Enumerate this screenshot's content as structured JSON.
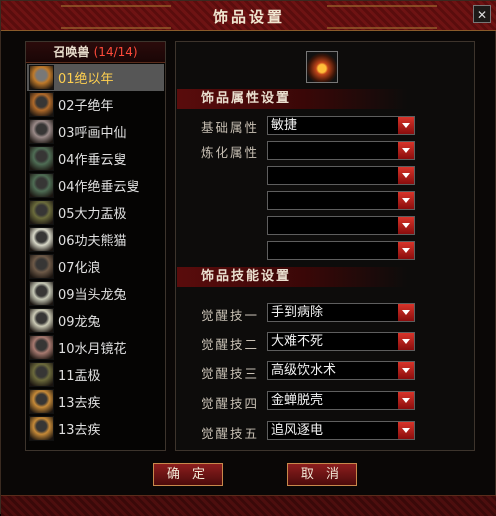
{
  "window": {
    "title": "饰品设置",
    "close_icon": "✕"
  },
  "summon_list": {
    "header_label": "召唤兽",
    "count": "(14/14)",
    "items": [
      {
        "label": "01绝以年",
        "selected": true,
        "color": "#c07a2a"
      },
      {
        "label": "02子绝年",
        "color": "#b06a2a"
      },
      {
        "label": "03呼画中仙",
        "color": "#9a8a88"
      },
      {
        "label": "04作垂云叟",
        "color": "#4f6d55"
      },
      {
        "label": "04作绝垂云叟",
        "color": "#4f6d55"
      },
      {
        "label": "05大力盂极",
        "color": "#6b6c3c"
      },
      {
        "label": "06功夫熊猫",
        "color": "#d8d8c8"
      },
      {
        "label": "07化浪",
        "color": "#6e5a48"
      },
      {
        "label": "09当头龙兔",
        "color": "#c6c8b6"
      },
      {
        "label": "09龙兔",
        "color": "#cccbb6"
      },
      {
        "label": "10水月镜花",
        "color": "#a87a70"
      },
      {
        "label": "11盂极",
        "color": "#6c6a3c"
      },
      {
        "label": "13去疾",
        "color": "#c68a38"
      },
      {
        "label": "13去疾",
        "color": "#c68a38"
      }
    ]
  },
  "attr_section": {
    "title": "饰品属性设置",
    "base_label": "基础属性",
    "base_value": "敏捷",
    "refine_label": "炼化属性",
    "refine_values": [
      "",
      "",
      "",
      "",
      ""
    ]
  },
  "skill_section": {
    "title": "饰品技能设置",
    "skills": [
      {
        "label": "觉醒技一",
        "value": "手到病除"
      },
      {
        "label": "觉醒技二",
        "value": "大难不死"
      },
      {
        "label": "觉醒技三",
        "value": "高级饮水术"
      },
      {
        "label": "觉醒技四",
        "value": "金蝉脱壳"
      },
      {
        "label": "觉醒技五",
        "value": "追风逐电"
      }
    ]
  },
  "buttons": {
    "confirm": "确 定",
    "cancel": "取 消"
  }
}
